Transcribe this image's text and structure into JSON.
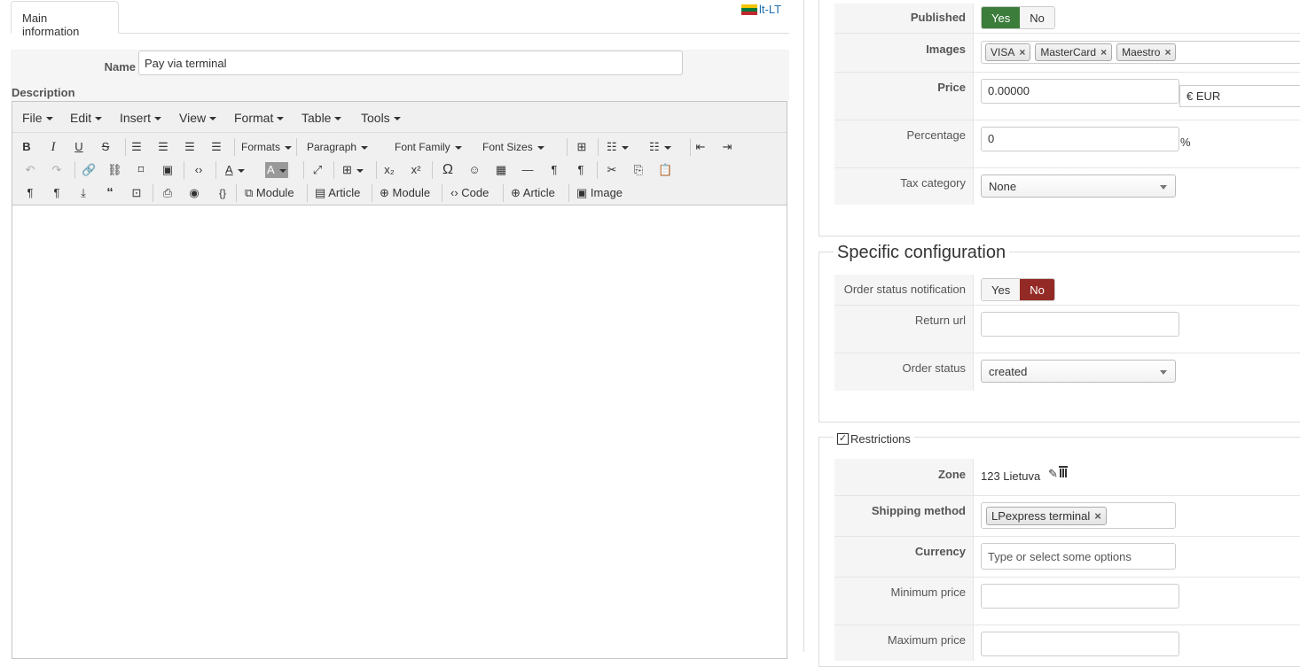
{
  "tabs": {
    "main": "Main information"
  },
  "lang": "lt-LT",
  "flag_colors": [
    "#f3c400",
    "#007a3d",
    "#c1272d"
  ],
  "name": {
    "label": "Name",
    "value": "Pay via terminal"
  },
  "description": {
    "label": "Description"
  },
  "editor": {
    "menus": [
      "File",
      "Edit",
      "Insert",
      "View",
      "Format",
      "Table",
      "Tools"
    ],
    "toolbar1": {
      "formats": "Formats",
      "paragraph": "Paragraph",
      "font_family": "Font Family",
      "font_sizes": "Font Sizes"
    },
    "toolbar3": {
      "module1": "Module",
      "article1": "Article",
      "module2": "Module",
      "code": "Code",
      "article2": "Article",
      "image": "Image"
    }
  },
  "general": {
    "published": {
      "label": "Published",
      "yes": "Yes",
      "no": "No"
    },
    "images": {
      "label": "Images",
      "tags": [
        "VISA",
        "MasterCard",
        "Maestro"
      ]
    },
    "price": {
      "label": "Price",
      "value": "0.00000",
      "currency": "€ EUR"
    },
    "percentage": {
      "label": "Percentage",
      "value": "0",
      "unit": "%"
    },
    "tax": {
      "label": "Tax category",
      "value": "None"
    }
  },
  "specific": {
    "title": "Specific configuration",
    "notification": {
      "label": "Order status notification",
      "yes": "Yes",
      "no": "No"
    },
    "return_url": {
      "label": "Return url",
      "value": ""
    },
    "order_status": {
      "label": "Order status",
      "value": "created"
    }
  },
  "restrictions": {
    "title": "Restrictions",
    "zone": {
      "label": "Zone",
      "value": "123 Lietuva"
    },
    "shipping": {
      "label": "Shipping method",
      "tag": "LPexpress terminal"
    },
    "currency": {
      "label": "Currency",
      "placeholder": "Type or select some options"
    },
    "min_price": {
      "label": "Minimum price",
      "value": ""
    },
    "max_price": {
      "label": "Maximum price",
      "value": ""
    }
  }
}
